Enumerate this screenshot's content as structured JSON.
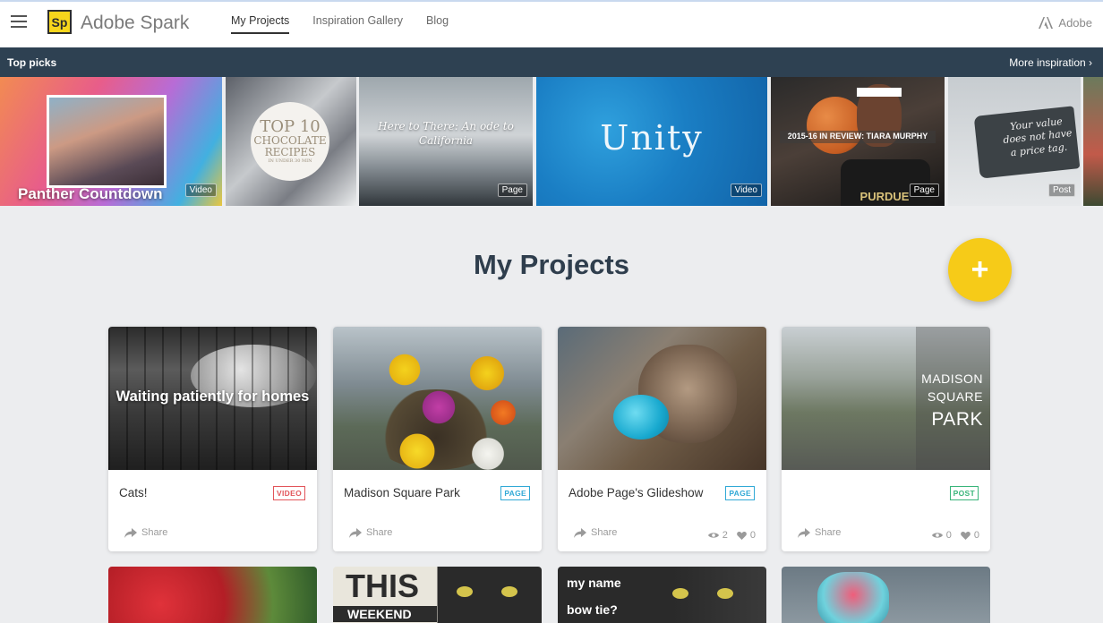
{
  "app": {
    "logo_letters": "Sp",
    "brand_name": "Adobe Spark",
    "adobe_label": "Adobe"
  },
  "nav": {
    "tabs": [
      {
        "label": "My Projects",
        "active": true
      },
      {
        "label": "Inspiration Gallery",
        "active": false
      },
      {
        "label": "Blog",
        "active": false
      }
    ]
  },
  "top_picks": {
    "title": "Top picks",
    "more_link": "More inspiration ›",
    "items": [
      {
        "text": "Panther Countdown",
        "type": "Video"
      },
      {
        "text_lines": [
          "TOP 10",
          "CHOCOLATE",
          "RECIPES",
          "IN UNDER 30 MIN"
        ],
        "type": ""
      },
      {
        "text": "Here to There: An ode to California",
        "type": "Page"
      },
      {
        "text": "Unity",
        "type": "Video"
      },
      {
        "text": "2015-16 IN REVIEW: TIARA MURPHY",
        "jersey": "PURDUE",
        "type": "Page"
      },
      {
        "text": "Your value does not have a price tag.",
        "type": "Post"
      }
    ]
  },
  "main": {
    "title": "My Projects",
    "fab_label": "+"
  },
  "projects": [
    {
      "overlay": "Waiting patiently for homes",
      "name": "Cats!",
      "type": "VIDEO",
      "share": "Share",
      "views": "",
      "likes": ""
    },
    {
      "overlay": "",
      "name": "Madison Square Park",
      "type": "PAGE",
      "share": "Share",
      "views": "",
      "likes": ""
    },
    {
      "overlay": "",
      "name": "Adobe Page's Glideshow",
      "type": "PAGE",
      "share": "Share",
      "views": "2",
      "likes": "0"
    },
    {
      "overlay_lines": [
        "MADISON",
        "SQUARE",
        "PARK"
      ],
      "name": "",
      "type": "POST",
      "share": "Share",
      "views": "0",
      "likes": "0"
    }
  ],
  "projects_row2": [
    {
      "text": ""
    },
    {
      "text_big": "THIS",
      "text_small": "WEEKEND"
    },
    {
      "text_top": "my name",
      "text_bottom": "bow tie?"
    },
    {
      "text": ""
    }
  ]
}
